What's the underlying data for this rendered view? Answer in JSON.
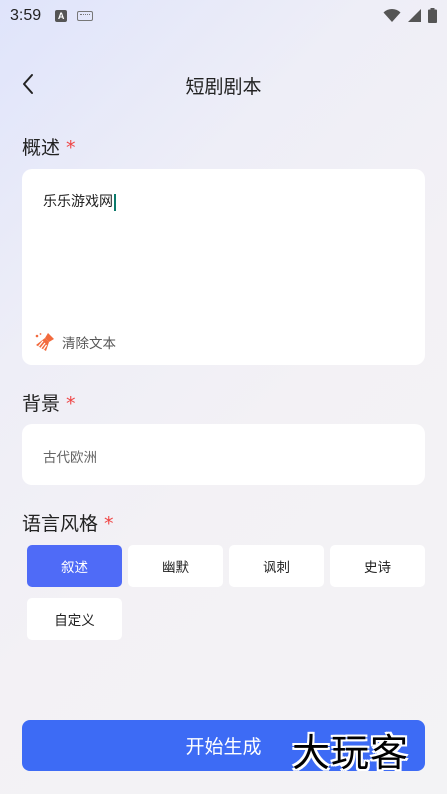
{
  "status_bar": {
    "time": "3:59",
    "a_icon_letter": "A"
  },
  "header": {
    "title": "短剧剧本"
  },
  "summary": {
    "label": "概述",
    "required_mark": "*",
    "value": "乐乐游戏网",
    "clear_label": "清除文本"
  },
  "background": {
    "label": "背景",
    "required_mark": "*",
    "value": "古代欧洲"
  },
  "language_style": {
    "label": "语言风格",
    "required_mark": "*",
    "options": [
      "叙述",
      "幽默",
      "讽刺",
      "史诗",
      "自定义"
    ],
    "selected": "叙述"
  },
  "start_button": {
    "label": "开始生成"
  },
  "watermark": {
    "text": "大玩客"
  },
  "colors": {
    "accent": "#3d6bf5",
    "selected_chip": "#4f6bf7",
    "required": "#ef4444"
  }
}
